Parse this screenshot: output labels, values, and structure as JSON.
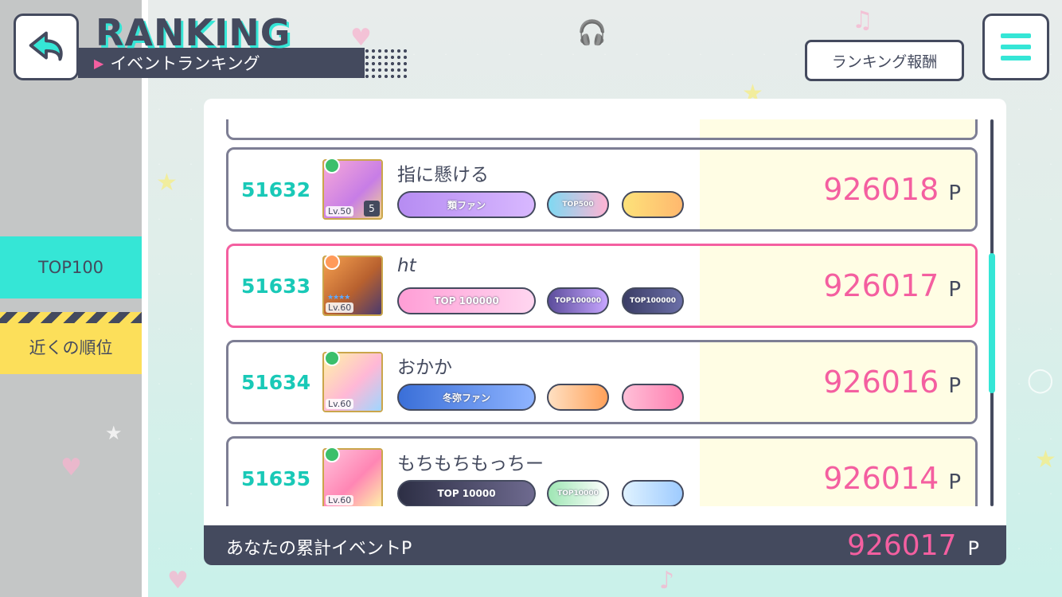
{
  "header": {
    "back_icon": "back-arrow-icon",
    "title": "RANKING",
    "subtitle": "イベントランキング",
    "reward_button": "ランキング報酬",
    "menu_icon": "hamburger-menu-icon"
  },
  "sidebar": {
    "tabs": [
      {
        "label": "TOP100"
      },
      {
        "label": "近くの順位"
      }
    ]
  },
  "ranking": {
    "rows": [
      {
        "rank": "51632",
        "name": "指に懸ける",
        "level": "Lv.50",
        "master_rank": "5",
        "points": "926018",
        "unit": "P",
        "badges": [
          "類ファン",
          "",
          ""
        ]
      },
      {
        "rank": "51633",
        "name": "ht",
        "level": "Lv.60",
        "points": "926017",
        "unit": "P",
        "badges": [
          "TOP 100000",
          "TOP100000",
          "TOP100000"
        ]
      },
      {
        "rank": "51634",
        "name": "おかか",
        "level": "Lv.60",
        "points": "926016",
        "unit": "P",
        "badges": [
          "冬弥ファン",
          "",
          ""
        ]
      },
      {
        "rank": "51635",
        "name": "もちもちもっちー",
        "level": "Lv.60",
        "points": "926014",
        "unit": "P",
        "badges": [
          "TOP 10000",
          "TOP10000",
          ""
        ]
      }
    ],
    "badge_sub": [
      "TOP500"
    ]
  },
  "footer": {
    "label": "あなたの累計イベントP",
    "value": "926017",
    "unit": "P"
  },
  "colors": {
    "accent": "#35e6d6",
    "navy": "#444a5e",
    "pink": "#f45fa0",
    "yellow": "#fcdf5a"
  }
}
